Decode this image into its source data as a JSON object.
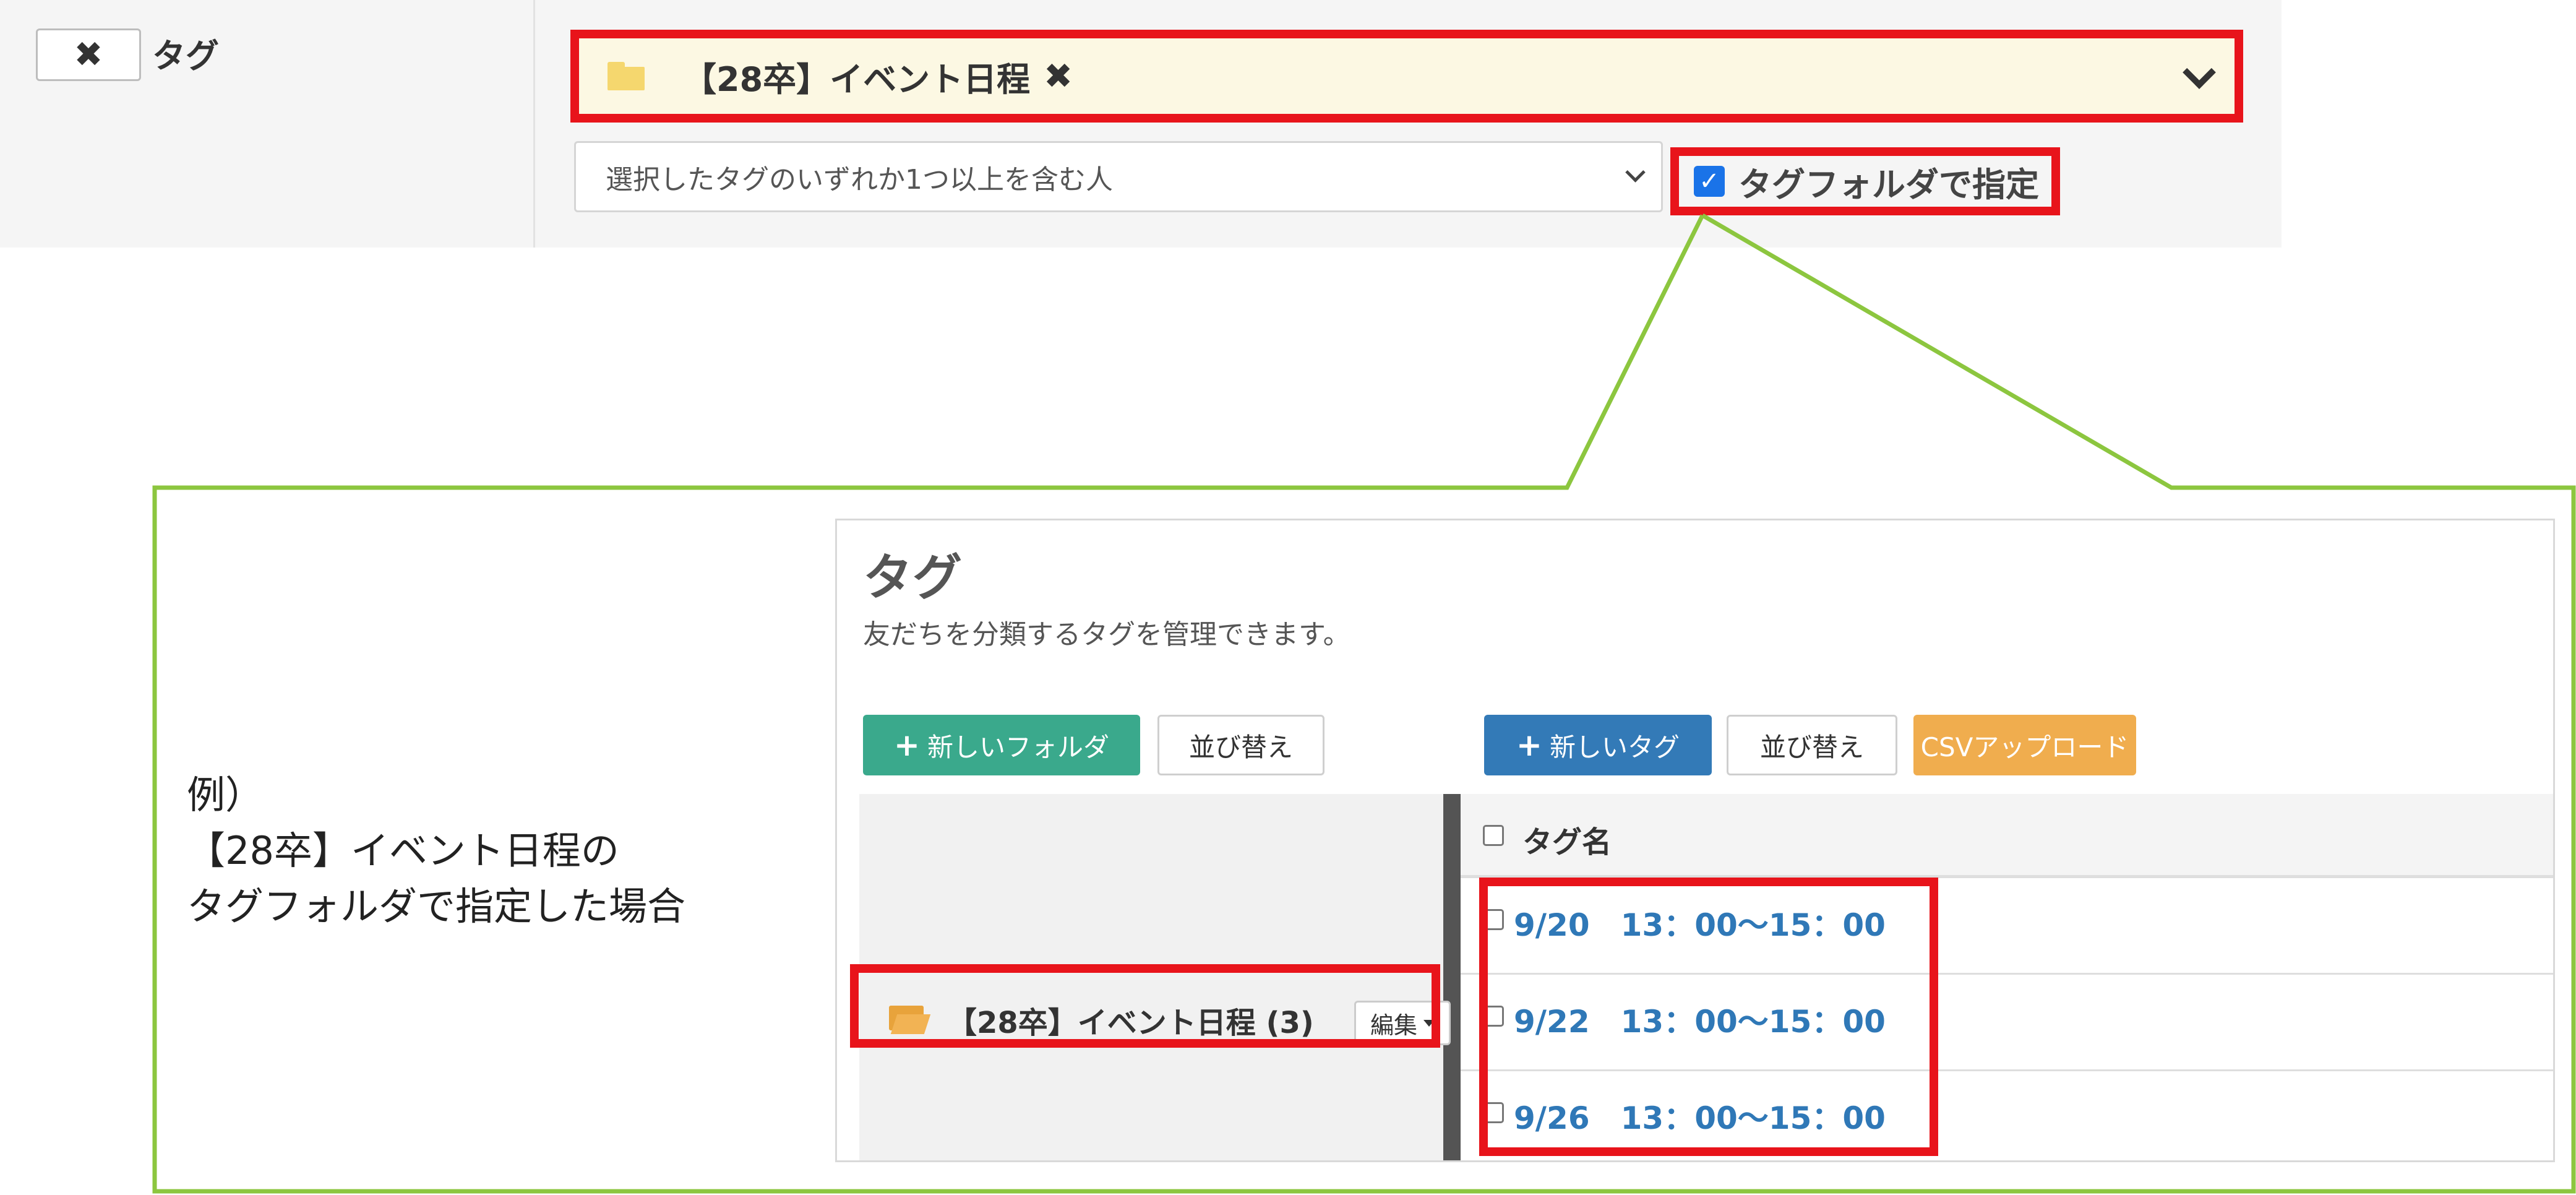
{
  "filter": {
    "remove_button_icon": "✖",
    "condition_label": "タグ",
    "selected_tag": "【28卒】イベント日程",
    "remove_tag_icon": "✖",
    "match_mode": "選択したタグのいずれか1つ以上を含む人",
    "folder_mode_label": "タグフォルダで指定",
    "folder_mode_checked": true
  },
  "caption": {
    "line1": "例）",
    "line2": "【28卒】イベント日程の",
    "line3": "タグフォルダで指定した場合"
  },
  "tag_manager": {
    "title": "タグ",
    "subtitle": "友だちを分類するタグを管理できます。",
    "new_folder_label": "新しいフォルダ",
    "folder_sort_label": "並び替え",
    "new_tag_label": "新しいタグ",
    "tag_sort_label": "並び替え",
    "csv_upload_label": "CSVアップロード",
    "folder": {
      "name": "【28卒】イベント日程 (3)",
      "edit_label": "編集"
    },
    "table": {
      "header": "タグ名",
      "rows": [
        "9/20　13：00～15：00",
        "9/22　13：00～15：00",
        "9/26　13：00～15：00"
      ]
    }
  },
  "colors": {
    "highlight_red": "#e8141b",
    "callout_green": "#8cc63f",
    "link_blue": "#2f78b7",
    "new_folder_green": "#3aa98c",
    "new_tag_blue": "#337ab7",
    "csv_orange": "#f0ad4e",
    "selected_bg": "#fcf8e3"
  }
}
